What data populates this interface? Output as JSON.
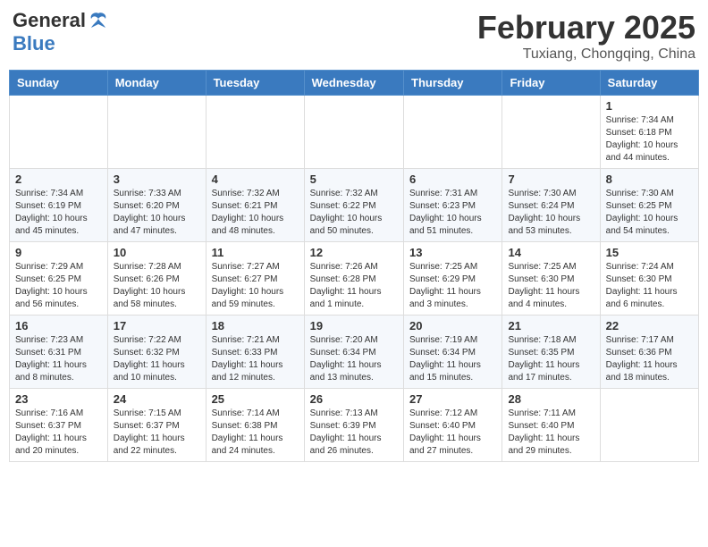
{
  "header": {
    "logo_general": "General",
    "logo_blue": "Blue",
    "month": "February 2025",
    "location": "Tuxiang, Chongqing, China"
  },
  "weekdays": [
    "Sunday",
    "Monday",
    "Tuesday",
    "Wednesday",
    "Thursday",
    "Friday",
    "Saturday"
  ],
  "weeks": [
    [
      {
        "day": "",
        "info": ""
      },
      {
        "day": "",
        "info": ""
      },
      {
        "day": "",
        "info": ""
      },
      {
        "day": "",
        "info": ""
      },
      {
        "day": "",
        "info": ""
      },
      {
        "day": "",
        "info": ""
      },
      {
        "day": "1",
        "info": "Sunrise: 7:34 AM\nSunset: 6:18 PM\nDaylight: 10 hours\nand 44 minutes."
      }
    ],
    [
      {
        "day": "2",
        "info": "Sunrise: 7:34 AM\nSunset: 6:19 PM\nDaylight: 10 hours\nand 45 minutes."
      },
      {
        "day": "3",
        "info": "Sunrise: 7:33 AM\nSunset: 6:20 PM\nDaylight: 10 hours\nand 47 minutes."
      },
      {
        "day": "4",
        "info": "Sunrise: 7:32 AM\nSunset: 6:21 PM\nDaylight: 10 hours\nand 48 minutes."
      },
      {
        "day": "5",
        "info": "Sunrise: 7:32 AM\nSunset: 6:22 PM\nDaylight: 10 hours\nand 50 minutes."
      },
      {
        "day": "6",
        "info": "Sunrise: 7:31 AM\nSunset: 6:23 PM\nDaylight: 10 hours\nand 51 minutes."
      },
      {
        "day": "7",
        "info": "Sunrise: 7:30 AM\nSunset: 6:24 PM\nDaylight: 10 hours\nand 53 minutes."
      },
      {
        "day": "8",
        "info": "Sunrise: 7:30 AM\nSunset: 6:25 PM\nDaylight: 10 hours\nand 54 minutes."
      }
    ],
    [
      {
        "day": "9",
        "info": "Sunrise: 7:29 AM\nSunset: 6:25 PM\nDaylight: 10 hours\nand 56 minutes."
      },
      {
        "day": "10",
        "info": "Sunrise: 7:28 AM\nSunset: 6:26 PM\nDaylight: 10 hours\nand 58 minutes."
      },
      {
        "day": "11",
        "info": "Sunrise: 7:27 AM\nSunset: 6:27 PM\nDaylight: 10 hours\nand 59 minutes."
      },
      {
        "day": "12",
        "info": "Sunrise: 7:26 AM\nSunset: 6:28 PM\nDaylight: 11 hours\nand 1 minute."
      },
      {
        "day": "13",
        "info": "Sunrise: 7:25 AM\nSunset: 6:29 PM\nDaylight: 11 hours\nand 3 minutes."
      },
      {
        "day": "14",
        "info": "Sunrise: 7:25 AM\nSunset: 6:30 PM\nDaylight: 11 hours\nand 4 minutes."
      },
      {
        "day": "15",
        "info": "Sunrise: 7:24 AM\nSunset: 6:30 PM\nDaylight: 11 hours\nand 6 minutes."
      }
    ],
    [
      {
        "day": "16",
        "info": "Sunrise: 7:23 AM\nSunset: 6:31 PM\nDaylight: 11 hours\nand 8 minutes."
      },
      {
        "day": "17",
        "info": "Sunrise: 7:22 AM\nSunset: 6:32 PM\nDaylight: 11 hours\nand 10 minutes."
      },
      {
        "day": "18",
        "info": "Sunrise: 7:21 AM\nSunset: 6:33 PM\nDaylight: 11 hours\nand 12 minutes."
      },
      {
        "day": "19",
        "info": "Sunrise: 7:20 AM\nSunset: 6:34 PM\nDaylight: 11 hours\nand 13 minutes."
      },
      {
        "day": "20",
        "info": "Sunrise: 7:19 AM\nSunset: 6:34 PM\nDaylight: 11 hours\nand 15 minutes."
      },
      {
        "day": "21",
        "info": "Sunrise: 7:18 AM\nSunset: 6:35 PM\nDaylight: 11 hours\nand 17 minutes."
      },
      {
        "day": "22",
        "info": "Sunrise: 7:17 AM\nSunset: 6:36 PM\nDaylight: 11 hours\nand 18 minutes."
      }
    ],
    [
      {
        "day": "23",
        "info": "Sunrise: 7:16 AM\nSunset: 6:37 PM\nDaylight: 11 hours\nand 20 minutes."
      },
      {
        "day": "24",
        "info": "Sunrise: 7:15 AM\nSunset: 6:37 PM\nDaylight: 11 hours\nand 22 minutes."
      },
      {
        "day": "25",
        "info": "Sunrise: 7:14 AM\nSunset: 6:38 PM\nDaylight: 11 hours\nand 24 minutes."
      },
      {
        "day": "26",
        "info": "Sunrise: 7:13 AM\nSunset: 6:39 PM\nDaylight: 11 hours\nand 26 minutes."
      },
      {
        "day": "27",
        "info": "Sunrise: 7:12 AM\nSunset: 6:40 PM\nDaylight: 11 hours\nand 27 minutes."
      },
      {
        "day": "28",
        "info": "Sunrise: 7:11 AM\nSunset: 6:40 PM\nDaylight: 11 hours\nand 29 minutes."
      },
      {
        "day": "",
        "info": ""
      }
    ]
  ]
}
